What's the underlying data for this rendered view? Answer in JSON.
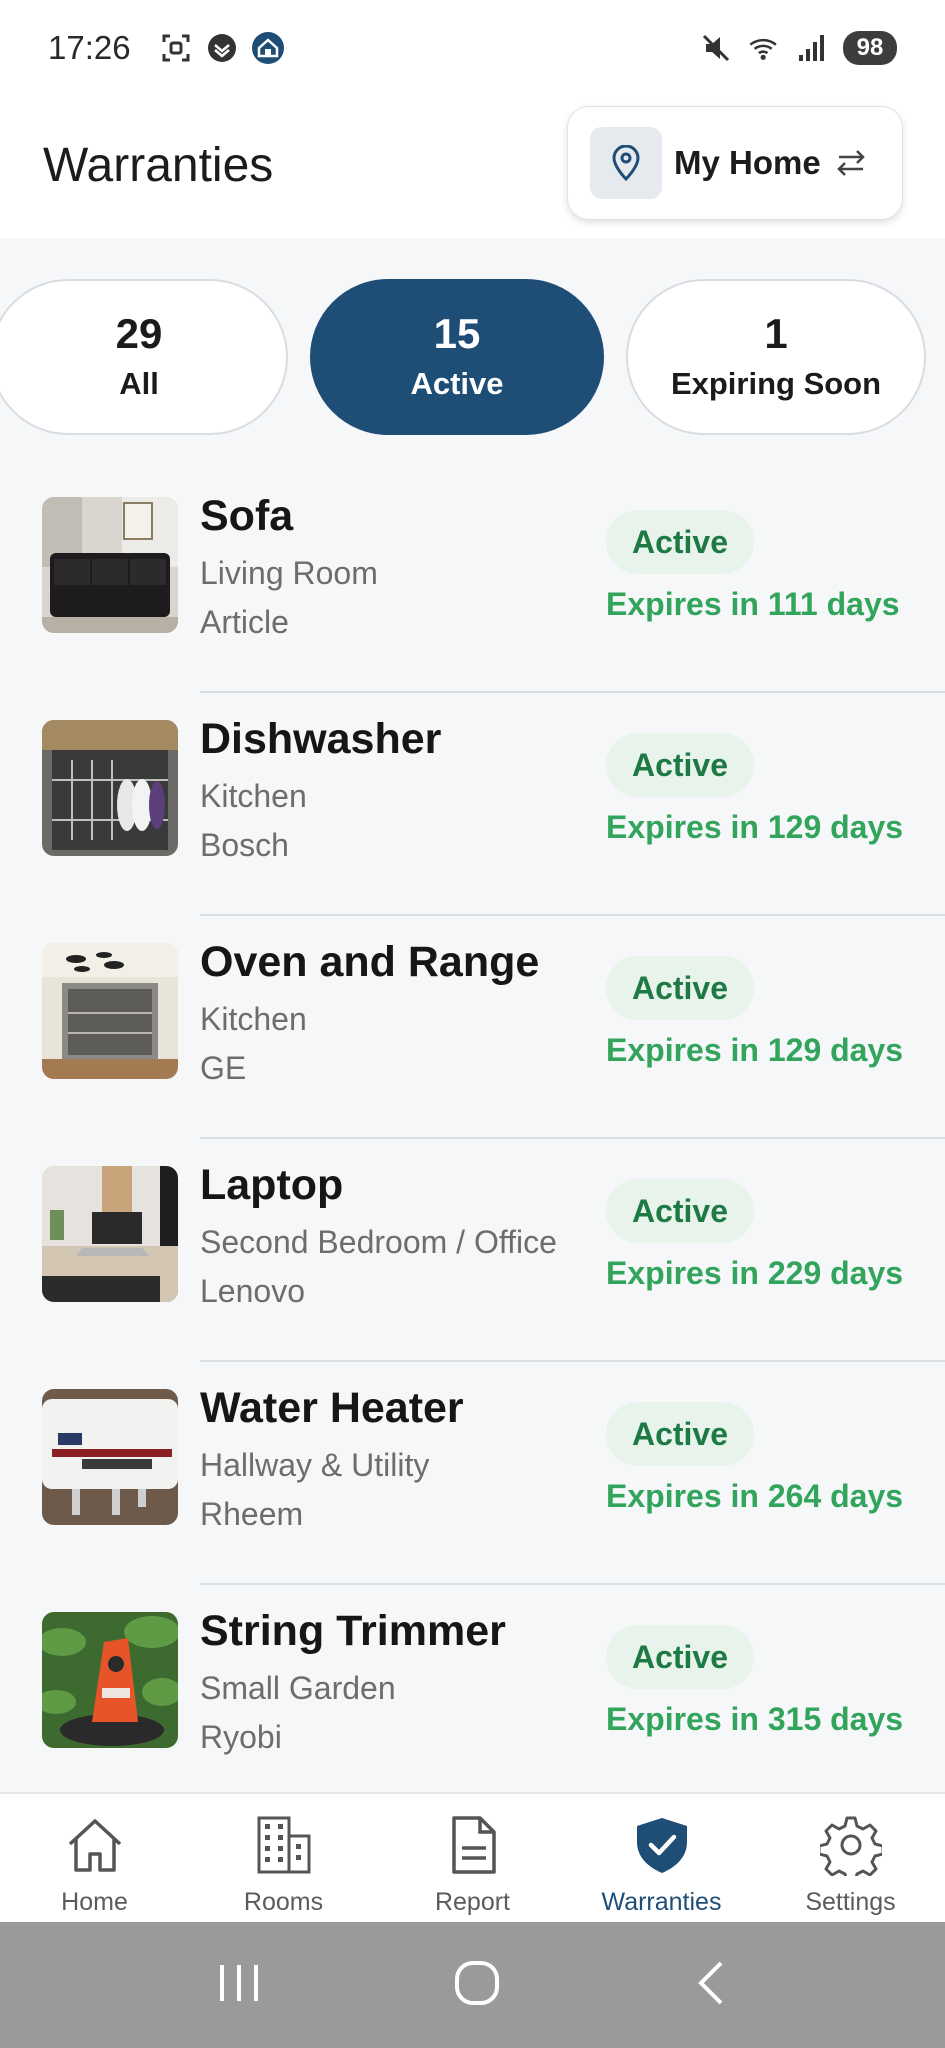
{
  "status_bar": {
    "time": "17:26",
    "battery": "98",
    "left_icons": [
      "screenshot-icon",
      "vpn-shield-icon",
      "home-app-icon"
    ],
    "right_icons": [
      "mute-icon",
      "wifi-icon",
      "signal-icon"
    ]
  },
  "header": {
    "title": "Warranties",
    "home_name": "My Home"
  },
  "filters": [
    {
      "count": "29",
      "label": "All"
    },
    {
      "count": "15",
      "label": "Active"
    },
    {
      "count": "1",
      "label": "Expiring Soon"
    }
  ],
  "items": [
    {
      "name": "Sofa",
      "room": "Living Room",
      "brand": "Article",
      "status": "Active",
      "expires": "Expires in 111 days"
    },
    {
      "name": "Dishwasher",
      "room": "Kitchen",
      "brand": "Bosch",
      "status": "Active",
      "expires": "Expires in 129 days"
    },
    {
      "name": "Oven and Range",
      "room": "Kitchen",
      "brand": "GE",
      "status": "Active",
      "expires": "Expires in 129 days"
    },
    {
      "name": "Laptop",
      "room": "Second Bedroom / Office",
      "brand": "Lenovo",
      "status": "Active",
      "expires": "Expires in 229 days"
    },
    {
      "name": "Water Heater",
      "room": "Hallway & Utility",
      "brand": "Rheem",
      "status": "Active",
      "expires": "Expires in 264 days"
    },
    {
      "name": "String Trimmer",
      "room": "Small Garden",
      "brand": "Ryobi",
      "status": "Active",
      "expires": "Expires in 315 days"
    }
  ],
  "bottom_nav": [
    {
      "label": "Home",
      "icon": "home-icon"
    },
    {
      "label": "Rooms",
      "icon": "building-icon"
    },
    {
      "label": "Report",
      "icon": "document-icon"
    },
    {
      "label": "Warranties",
      "icon": "shield-check-icon"
    },
    {
      "label": "Settings",
      "icon": "gear-icon"
    }
  ],
  "colors": {
    "primary": "#1e4d76",
    "active_badge_bg": "#e8f3ec",
    "active_badge_text": "#1e7a44",
    "expires_text": "#32a45c"
  }
}
